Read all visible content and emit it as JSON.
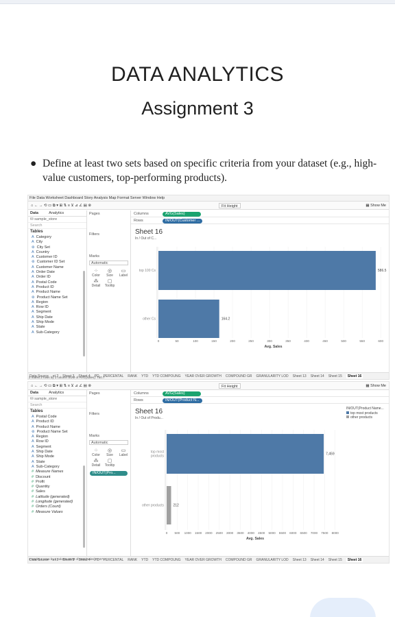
{
  "document": {
    "title": "DATA ANALYTICS",
    "subtitle": "Assignment 3",
    "bullet": "Define at least two sets based on specific criteria from your dataset (e.g., high-value customers, top-performing products)."
  },
  "app": {
    "menu": "File  Data  Worksheet  Dashboard  Story  Analysis  Map  Format  Server  Window  Help",
    "fit": "Fit Height",
    "show_me": "Show Me",
    "tab_data": "Data",
    "tab_analytics": "Analytics",
    "datasource": "sample_store",
    "search": "Search",
    "tables": "Tables",
    "pages": "Pages",
    "filters": "Filters",
    "marks": "Marks",
    "automatic": "Automatic",
    "mark_buttons": [
      "Color",
      "Size",
      "Label",
      "Detail",
      "Tooltip"
    ],
    "columns_label": "Columns",
    "rows_label": "Rows",
    "sheet_tabs": [
      "Data Source",
      "et 2",
      "Sheet 3",
      "Sheet 4",
      "PD",
      "PERCENTAL",
      "RANK",
      "YTD",
      "YTD COMPOUNG",
      "YEAR OVER GROWTH",
      "COMPOUND GR",
      "GRANULARITY LOD",
      "Sheet 13",
      "Sheet 14",
      "Sheet 15",
      "Sheet 16"
    ]
  },
  "screen1": {
    "fields": [
      "Category",
      "City",
      "City Set",
      "Country",
      "Customer ID",
      "Customer ID Set",
      "Customer Name",
      "Order Date",
      "Order ID",
      "Postal Code",
      "Product ID",
      "Product Name",
      "Product Name Set",
      "Region",
      "Row ID",
      "Segment",
      "Ship Date",
      "Ship Mode",
      "State",
      "Sub-Category"
    ],
    "columns_pill": "AVG(Sales)",
    "rows_pill": "IN/OUT(Customer ...",
    "sheet": "Sheet 16",
    "sheet_sub": "In / Out of C...",
    "status": "2 marks   2 rows by 1 column   SUM of AVG(Sales): 750.7"
  },
  "screen2": {
    "fields": [
      "Postal Code",
      "Product ID",
      "Product Name",
      "Product Name Set",
      "Region",
      "Row ID",
      "Segment",
      "Ship Date",
      "Ship Mode",
      "State",
      "Sub-Category",
      "Measure Names",
      "Discount",
      "Profit",
      "Quantity",
      "Sales",
      "Latitude (generated)",
      "Longitude (generated)",
      "Orders (Count)",
      "Measure Values"
    ],
    "italic_fields": [
      "Measure Names",
      "Latitude (generated)",
      "Longitude (generated)",
      "Orders (Count)",
      "Measure Values"
    ],
    "marks_pill": "IN/OUT(Pro...",
    "columns_pill": "AVG(Sales)",
    "rows_pill": "IN/OUT(Product N...",
    "sheet": "Sheet 16",
    "sheet_sub": "In / Out of Produ...",
    "legend_title": "IN/OUT(Product Name...",
    "legend_items": [
      "top most products",
      "other products"
    ],
    "status": "2 marks   2 rows by 1 column   SUM of AVG(Sales): 7,671"
  },
  "chart_data": [
    {
      "type": "bar",
      "orientation": "horizontal",
      "categories": [
        "top 100 Cs",
        "other Cs"
      ],
      "values": [
        586.5,
        164.2
      ],
      "data_labels": [
        "586.5",
        "164.2"
      ],
      "xlabel": "Avg. Sales",
      "xticks": [
        0,
        50,
        100,
        150,
        200,
        250,
        300,
        350,
        400,
        450,
        500,
        550,
        600
      ],
      "xlim": [
        0,
        620
      ],
      "color": "#4e79a7"
    },
    {
      "type": "bar",
      "orientation": "horizontal",
      "categories": [
        "top most products",
        "other products"
      ],
      "values": [
        7459,
        212
      ],
      "data_labels": [
        "7,459",
        "212"
      ],
      "xlabel": "Avg. Sales",
      "xticks": [
        0,
        500,
        1000,
        1500,
        2000,
        2500,
        3000,
        3500,
        4000,
        4500,
        5000,
        5500,
        6000,
        6500,
        7000,
        7500,
        8000
      ],
      "xlim": [
        0,
        8400
      ],
      "colors": [
        "#4e79a7",
        "#a0a0a0"
      ]
    }
  ]
}
